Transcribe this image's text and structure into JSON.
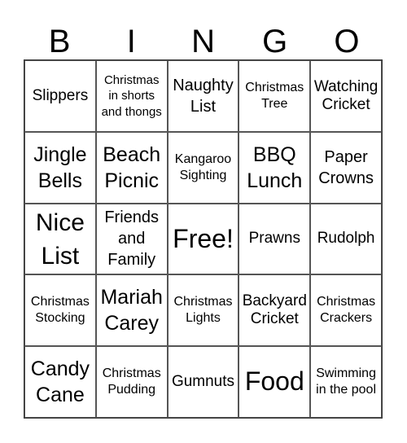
{
  "header": {
    "letters": [
      "B",
      "I",
      "N",
      "G",
      "O"
    ]
  },
  "grid": {
    "rows": [
      [
        {
          "text": "Slippers",
          "size": "s3"
        },
        {
          "text": "Christmas in shorts and thongs",
          "size": "s1"
        },
        {
          "text": "Naughty List",
          "size": "s4"
        },
        {
          "text": "Christmas Tree",
          "size": "s2"
        },
        {
          "text": "Watching Cricket",
          "size": "s3"
        }
      ],
      [
        {
          "text": "Jingle Bells",
          "size": "s5"
        },
        {
          "text": "Beach Picnic",
          "size": "s5"
        },
        {
          "text": "Kangaroo Sighting",
          "size": "s2"
        },
        {
          "text": "BBQ Lunch",
          "size": "s5"
        },
        {
          "text": "Paper Crowns",
          "size": "s4"
        }
      ],
      [
        {
          "text": "Nice List",
          "size": "s6"
        },
        {
          "text": "Friends and Family",
          "size": "s4"
        },
        {
          "text": "Free!",
          "size": "s7"
        },
        {
          "text": "Prawns",
          "size": "s3"
        },
        {
          "text": "Rudolph",
          "size": "s3"
        }
      ],
      [
        {
          "text": "Christmas Stocking",
          "size": "s2"
        },
        {
          "text": "Mariah Carey",
          "size": "s5"
        },
        {
          "text": "Christmas Lights",
          "size": "s2"
        },
        {
          "text": "Backyard Cricket",
          "size": "s3"
        },
        {
          "text": "Christmas Crackers",
          "size": "s2"
        }
      ],
      [
        {
          "text": "Candy Cane",
          "size": "s5"
        },
        {
          "text": "Christmas Pudding",
          "size": "s2"
        },
        {
          "text": "Gumnuts",
          "size": "s3"
        },
        {
          "text": "Food",
          "size": "s7"
        },
        {
          "text": "Swimming in the pool",
          "size": "s2"
        }
      ]
    ]
  }
}
